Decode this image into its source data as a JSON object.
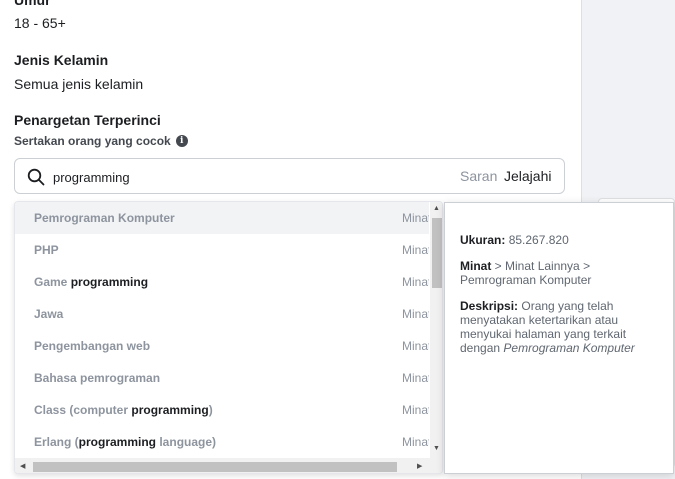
{
  "age": {
    "label": "Umur",
    "value": "18 - 65+"
  },
  "gender": {
    "label": "Jenis Kelamin",
    "value": "Semua jenis kelamin"
  },
  "detailed_targeting": {
    "title": "Penargetan Terperinci",
    "include_label": "Sertakan orang yang cocok",
    "info_icon": "info-icon",
    "search": {
      "value": "programming",
      "tab_suggestions": "Saran",
      "tab_browse": "Jelajahi"
    }
  },
  "dropdown": {
    "items": [
      {
        "pre": "Pemrograman Komputer",
        "match": "",
        "post": "",
        "type": "Minat"
      },
      {
        "pre": "PHP",
        "match": "",
        "post": "",
        "type": "Minat"
      },
      {
        "pre": "Game ",
        "match": "programming",
        "post": "",
        "type": "Minat"
      },
      {
        "pre": "Jawa",
        "match": "",
        "post": "",
        "type": "Minat"
      },
      {
        "pre": "Pengembangan web",
        "match": "",
        "post": "",
        "type": "Minat"
      },
      {
        "pre": "Bahasa pemrograman",
        "match": "",
        "post": "",
        "type": "Minat"
      },
      {
        "pre": "Class (computer ",
        "match": "programming",
        "post": ")",
        "type": "Minat"
      },
      {
        "pre": "Erlang (",
        "match": "programming",
        "post": " language)",
        "type": "Minat"
      }
    ]
  },
  "tooltip": {
    "size_label": "Ukuran:",
    "size_value": "85.267.820",
    "path_label": "Minat",
    "path_value": " > Minat Lainnya > Pemrograman Komputer",
    "desc_label": "Deskripsi:",
    "desc_value": " Orang yang telah menyatakan ketertarikan atau menyukai halaman yang terkait dengan ",
    "desc_topic": "Pemrograman Komputer"
  },
  "colors": {
    "text": "#1c1e21",
    "muted": "#8d949e",
    "border": "#ccd0d5",
    "highlight": "#f2f3f5"
  }
}
